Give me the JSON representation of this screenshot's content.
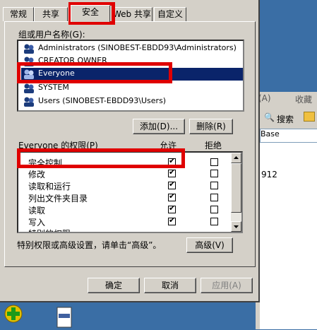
{
  "tabs": [
    {
      "label": "常规"
    },
    {
      "label": "共享"
    },
    {
      "label": "安全"
    },
    {
      "label": "Web 共享"
    },
    {
      "label": "自定义"
    }
  ],
  "group_label": "组或用户名称(G):",
  "users": [
    {
      "name": "Administrators (SINOBEST-EBDD93\\Administrators)"
    },
    {
      "name": "CREATOR OWNER"
    },
    {
      "name": "Everyone"
    },
    {
      "name": "SYSTEM"
    },
    {
      "name": "Users (SINOBEST-EBDD93\\Users)"
    }
  ],
  "selected_user_index": 2,
  "add_button": "添加(D)...",
  "remove_button": "删除(R)",
  "perm_label": "Everyone 的权限(P)",
  "allow_header": "允许",
  "deny_header": "拒绝",
  "permissions": [
    {
      "name": "完全控制",
      "allow": true,
      "deny": false
    },
    {
      "name": "修改",
      "allow": true,
      "deny": false
    },
    {
      "name": "读取和运行",
      "allow": true,
      "deny": false
    },
    {
      "name": "列出文件夹目录",
      "allow": true,
      "deny": false
    },
    {
      "name": "读取",
      "allow": true,
      "deny": false
    },
    {
      "name": "写入",
      "allow": true,
      "deny": false
    },
    {
      "name": "特别的权限",
      "allow": false,
      "deny": false
    }
  ],
  "advanced_text": "特别权限或高级设置，请单击“高级”。",
  "advanced_button": "高级(V)",
  "ok_button": "确定",
  "cancel_button": "取消",
  "apply_button": "应用(A)",
  "background": {
    "menu": [
      "(A)",
      "收藏"
    ],
    "search": "搜索",
    "address": "Base",
    "content": "912"
  }
}
